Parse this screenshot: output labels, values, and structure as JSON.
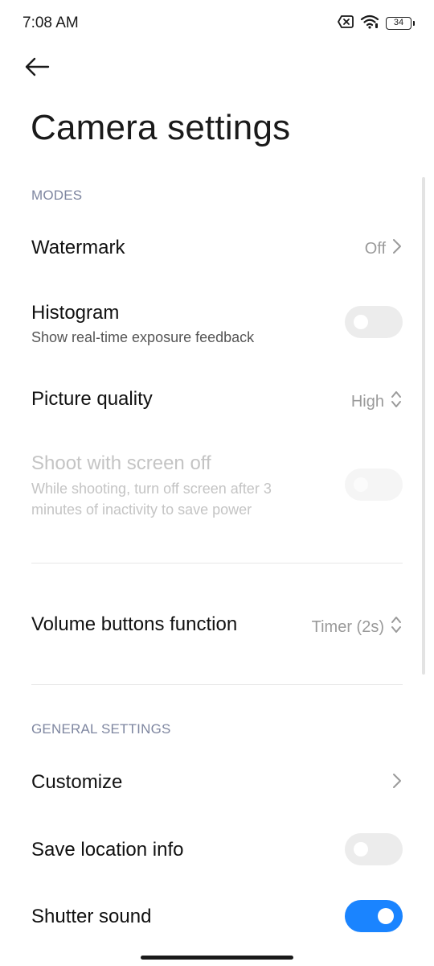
{
  "status_bar": {
    "time": "7:08 AM",
    "battery": "34",
    "icons": [
      "no-sim-icon",
      "wifi-icon",
      "battery-icon"
    ]
  },
  "header": {
    "back_icon": "arrow-left-icon",
    "title": "Camera settings"
  },
  "sections": {
    "modes": "MODES",
    "general": "GENERAL SETTINGS"
  },
  "rows": {
    "watermark": {
      "title": "Watermark",
      "value": "Off"
    },
    "histogram": {
      "title": "Histogram",
      "subtitle": "Show real-time exposure feedback",
      "enabled": false
    },
    "picture_quality": {
      "title": "Picture quality",
      "value": "High"
    },
    "screen_off": {
      "title": "Shoot with screen off",
      "subtitle_line1": "While shooting, turn off screen after 3",
      "subtitle_line2": "minutes of inactivity to save power",
      "enabled": false,
      "disabled": true
    },
    "volume_buttons": {
      "title": "Volume buttons function",
      "value": "Timer (2s)"
    },
    "customize": {
      "title": "Customize"
    },
    "save_location": {
      "title": "Save location info",
      "enabled": false
    },
    "shutter_sound": {
      "title": "Shutter sound",
      "enabled": true
    }
  },
  "colors": {
    "accent": "#1a84ff",
    "section_header": "#7e86a0",
    "value_text": "#9a9a9a",
    "disabled_text": "#c4c4c4"
  }
}
